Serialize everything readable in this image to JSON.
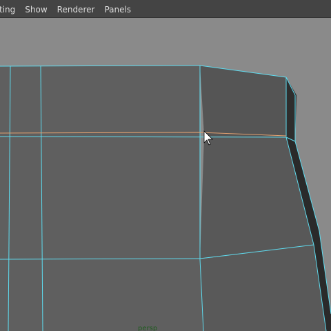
{
  "menubar": {
    "items": [
      {
        "label": "ting"
      },
      {
        "label": "Show"
      },
      {
        "label": "Renderer"
      },
      {
        "label": "Panels"
      }
    ]
  },
  "viewport": {
    "camera_label": "persp",
    "colors": {
      "background": "#8a8a8a",
      "mesh_face_light": "#5f5f5f",
      "mesh_face_dark": "#555555",
      "mesh_edge_dark": "#2a2a2a",
      "wire_selected": "#5fdcf0",
      "edge_highlight": "#e0a070",
      "camera_label": "#1e5c1e"
    },
    "cursor": "arrow-cursor-icon"
  }
}
